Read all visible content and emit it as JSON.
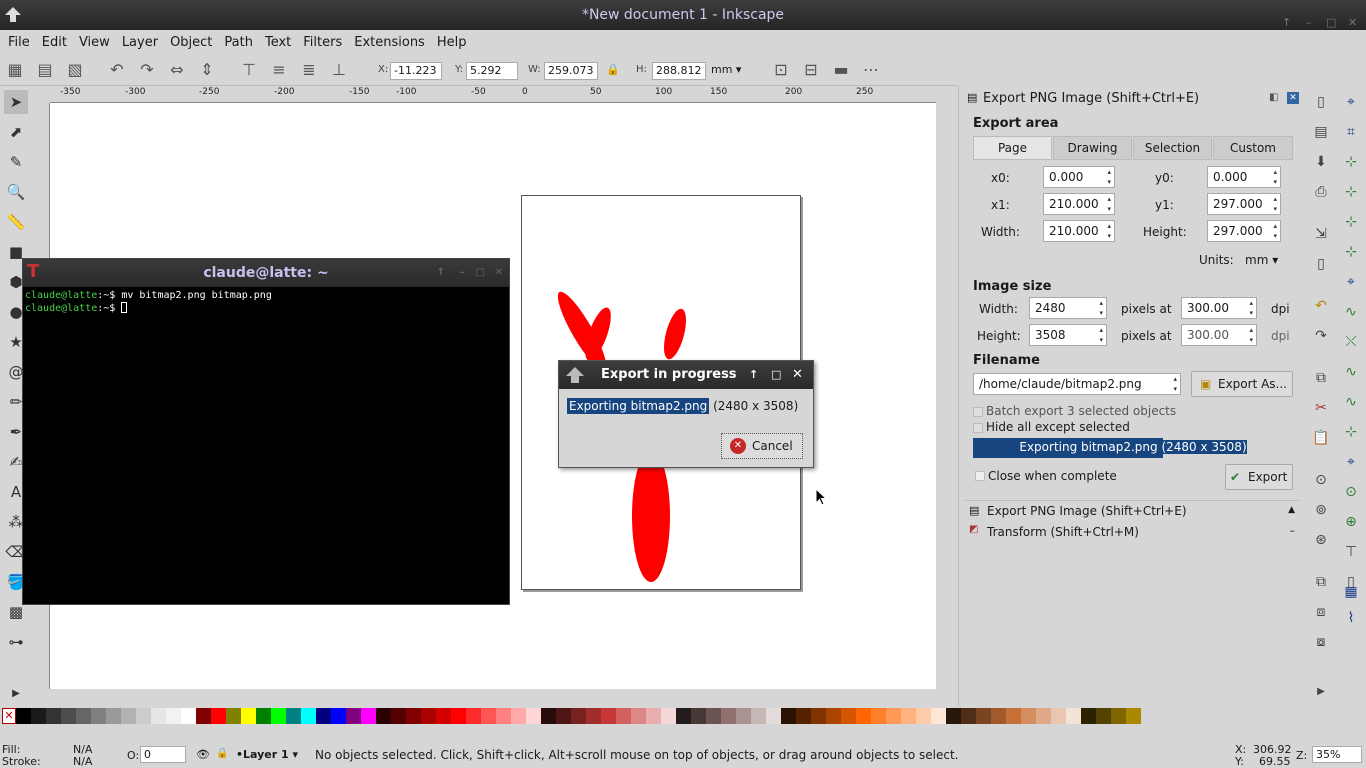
{
  "window": {
    "title": "*New document 1 - Inkscape"
  },
  "menu": [
    "File",
    "Edit",
    "View",
    "Layer",
    "Object",
    "Path",
    "Text",
    "Filters",
    "Extensions",
    "Help"
  ],
  "toolbar": {
    "x_label": "X:",
    "x_value": "-11.223",
    "y_label": "Y:",
    "y_value": "5.292",
    "w_label": "W:",
    "w_value": "259.073",
    "h_label": "H:",
    "h_value": "288.812",
    "unit": "mm"
  },
  "ruler": {
    "h_ticks": [
      "-350",
      "-300",
      "-250",
      "-200",
      "-150",
      "-100",
      "-50",
      "0",
      "50",
      "100",
      "150",
      "200",
      "250"
    ]
  },
  "terminal": {
    "title": "claude@latte: ~",
    "prompt": "claude@latte",
    "path": ":~$",
    "command": " mv bitmap2.png bitmap.png"
  },
  "progress_dialog": {
    "title": "Export in progress",
    "message_highlight": "Exporting bitmap2.png",
    "message_rest": " (2480 x 3508)",
    "cancel_label": "Cancel"
  },
  "export_panel": {
    "title": "Export PNG Image (Shift+Ctrl+E)",
    "export_area_heading": "Export area",
    "tabs": [
      "Page",
      "Drawing",
      "Selection",
      "Custom"
    ],
    "active_tab": "Page",
    "x0_label": "x0:",
    "x0": "0.000",
    "y0_label": "y0:",
    "y0": "0.000",
    "x1_label": "x1:",
    "x1": "210.000",
    "y1_label": "y1:",
    "y1": "297.000",
    "width_label": "Width:",
    "width": "210.000",
    "height_label": "Height:",
    "height": "297.000",
    "units_label": "Units:",
    "units": "mm",
    "image_size_heading": "Image size",
    "img_width_label": "Width:",
    "img_width": "2480",
    "img_height_label": "Height:",
    "img_height": "3508",
    "pixels_at": "pixels at",
    "dpi_x": "300.00",
    "dpi_y": "300.00",
    "dpi_label": "dpi",
    "filename_heading": "Filename",
    "filename": "/home/claude/bitmap2.png",
    "export_as_label": "Export As...",
    "batch_export_label": "Batch export 3 selected objects",
    "hide_all_label": "Hide all except selected",
    "progress_text": "Exporting bitmap2.png (2480 x 3508)",
    "close_when_complete_label": "Close when complete",
    "export_label": "Export"
  },
  "dock_list": [
    "Export PNG Image (Shift+Ctrl+E)",
    "Transform (Shift+Ctrl+M)"
  ],
  "palette": [
    "#000000",
    "#1a1a1a",
    "#333333",
    "#4d4d4d",
    "#666666",
    "#808080",
    "#999999",
    "#b3b3b3",
    "#cccccc",
    "#e6e6e6",
    "#f2f2f2",
    "#ffffff",
    "#800000",
    "#ff0000",
    "#808000",
    "#ffff00",
    "#008000",
    "#00ff00",
    "#008080",
    "#00ffff",
    "#000080",
    "#0000ff",
    "#800080",
    "#ff00ff",
    "#2b0000",
    "#550000",
    "#800000",
    "#aa0000",
    "#d40000",
    "#ff0000",
    "#ff2a2a",
    "#ff5555",
    "#ff8080",
    "#ffaaaa",
    "#ffd5d5",
    "#280b0b",
    "#501616",
    "#782121",
    "#a02c2c",
    "#c83737",
    "#d35f5f",
    "#de8787",
    "#e9afaf",
    "#f4d7d7",
    "#241c1c",
    "#483737",
    "#6c5353",
    "#916f6f",
    "#ac9393",
    "#c8b7b7",
    "#e3dbdb",
    "#2b1100",
    "#552200",
    "#803300",
    "#aa4400",
    "#d45500",
    "#ff6600",
    "#ff7f2a",
    "#ff9955",
    "#ffb380",
    "#ffccaa",
    "#ffe6d5",
    "#28170b",
    "#502d16",
    "#784421",
    "#a05a2c",
    "#c87137",
    "#d38d5f",
    "#deaa87",
    "#e9c6af",
    "#f4e3d7",
    "#2b2200",
    "#554400",
    "#806600",
    "#aa8800"
  ],
  "status": {
    "fill_label": "Fill:",
    "fill_value": "N/A",
    "stroke_label": "Stroke:",
    "stroke_value": "N/A",
    "opacity_label": "O:",
    "opacity_value": "0",
    "layer": "•Layer 1",
    "message": "No objects selected. Click, Shift+click, Alt+scroll mouse on top of objects, or drag around objects to select.",
    "x_label": "X:",
    "x": "306.92",
    "y_label": "Y:",
    "y": "69.55",
    "z_label": "Z:",
    "zoom": "35%"
  }
}
